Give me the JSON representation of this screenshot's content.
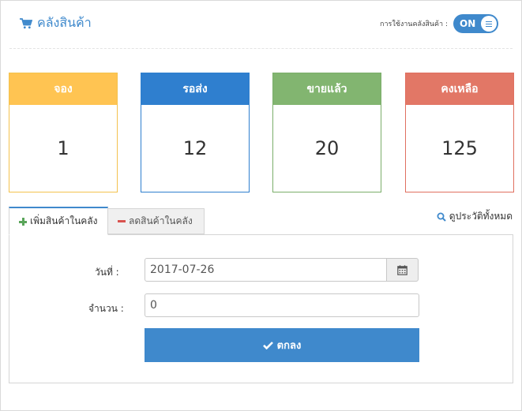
{
  "header": {
    "title": "คลังสินค้า",
    "icon": "shopping-cart-icon",
    "toggle_label": "การใช้งานคลังสินค้า :",
    "toggle_state": "ON"
  },
  "stats": [
    {
      "label": "จอง",
      "value": "1",
      "color": "#ffc452"
    },
    {
      "label": "รอส่ง",
      "value": "12",
      "color": "#2f7fcf"
    },
    {
      "label": "ขายแล้ว",
      "value": "20",
      "color": "#82b570"
    },
    {
      "label": "คงเหลือ",
      "value": "125",
      "color": "#e27766"
    }
  ],
  "tabs": [
    {
      "label": "เพิ่มสินค้าในคลัง",
      "icon": "plus-icon",
      "active": true
    },
    {
      "label": "ลดสินค้าในคลัง",
      "icon": "minus-icon",
      "active": false
    }
  ],
  "history_link": "ดูประวัติทั้งหมด",
  "form": {
    "date_label": "วันที่ :",
    "date_value": "2017-07-26",
    "quantity_label": "จำนวน :",
    "quantity_value": "0",
    "submit_label": "ตกลง"
  },
  "colors": {
    "accent": "#3f89cc"
  }
}
